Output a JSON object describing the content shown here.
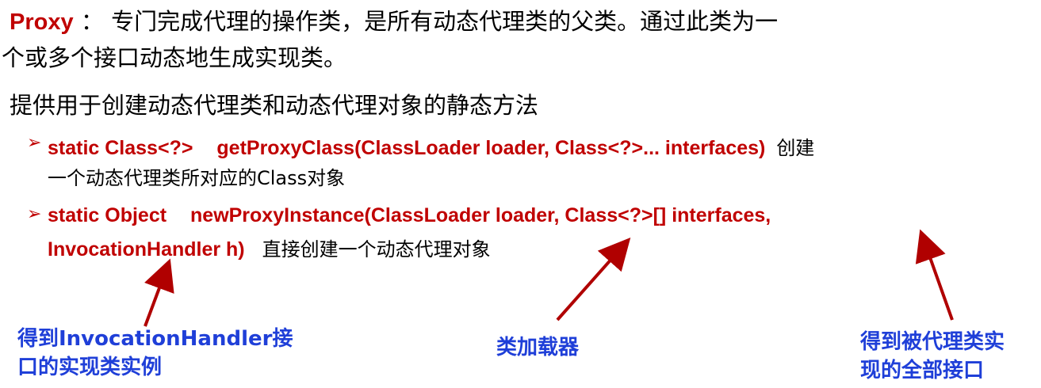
{
  "intro": {
    "keyword": "Proxy",
    "colon": "：",
    "line1_rest": "专门完成代理的操作类，是所有动态代理类的父类。通过此类为一",
    "line2": "个或多个接口动态地生成实现类。"
  },
  "subtitle": "提供用于创建动态代理类和动态代理对象的静态方法",
  "methods": [
    {
      "bullet": "➢",
      "sig_line1_a": "static Class<?>",
      "sig_line1_b": "getProxyClass(ClassLoader loader, Class<?>... interfaces)",
      "desc_tail1": "创建",
      "desc_line2": "一个动态代理类所对应的Class对象"
    },
    {
      "bullet": "➢",
      "sig_line1_a": "static Object",
      "sig_line1_b": "newProxyInstance(ClassLoader loader, Class<?>[] interfaces,",
      "sig_line2": "InvocationHandler h)",
      "desc": "直接创建一个动态代理对象"
    }
  ],
  "annotations": [
    {
      "line1": "得到InvocationHandler接",
      "line2": "口的实现类实例"
    },
    {
      "line1": "类加载器"
    },
    {
      "line1": "得到被代理类实",
      "line2": "现的全部接口"
    }
  ],
  "colors": {
    "red": "#c00000",
    "blue": "#1f3fd8",
    "arrow": "#b00000"
  }
}
